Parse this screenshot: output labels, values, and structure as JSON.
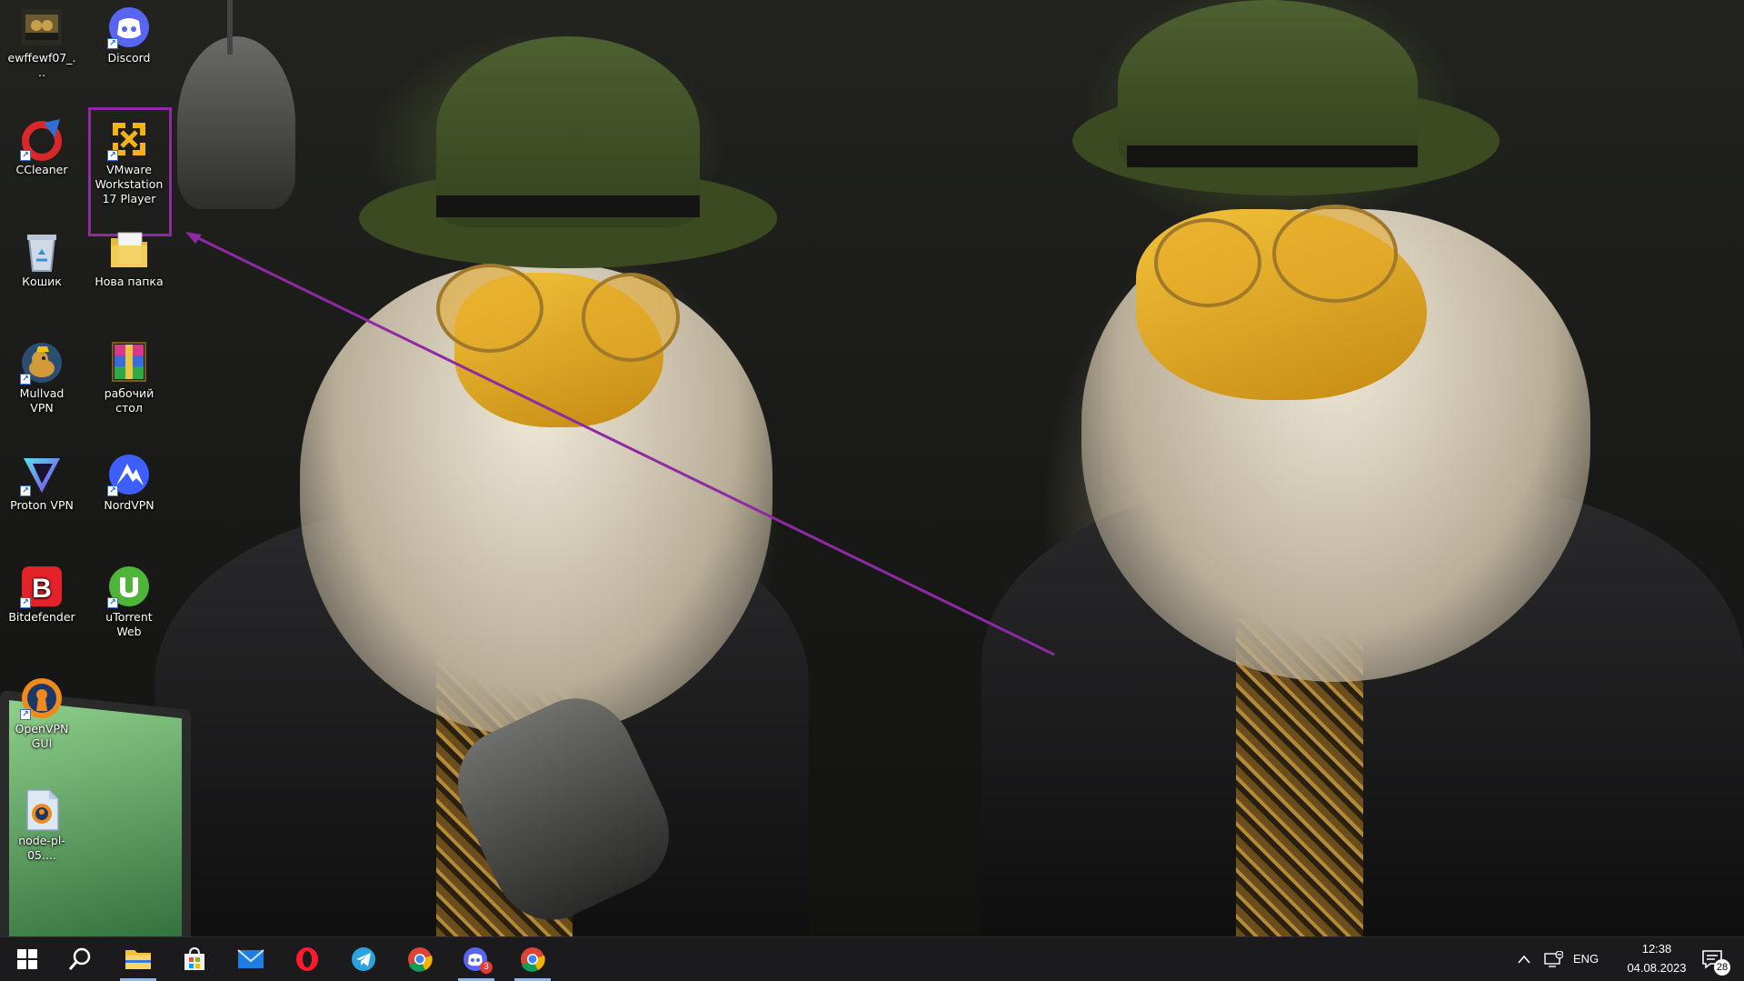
{
  "desktop": {
    "icons": [
      {
        "label": "ewffewf07_...",
        "icon": "game-thumbnail-icon"
      },
      {
        "label": "Discord",
        "icon": "discord-icon"
      },
      {
        "label": "CCleaner",
        "icon": "ccleaner-icon"
      },
      {
        "label": "VMware Workstation 17 Player",
        "icon": "vmware-icon",
        "selected": true
      },
      {
        "label": "Кошик",
        "icon": "recycle-bin-icon"
      },
      {
        "label": "Нова папка",
        "icon": "folder-icon"
      },
      {
        "label": "Mullvad VPN",
        "icon": "mullvad-icon"
      },
      {
        "label": "рабочий стол",
        "icon": "winrar-archive-icon"
      },
      {
        "label": "Proton VPN",
        "icon": "protonvpn-icon"
      },
      {
        "label": "NordVPN",
        "icon": "nordvpn-icon"
      },
      {
        "label": "Bitdefender",
        "icon": "bitdefender-icon"
      },
      {
        "label": "uTorrent Web",
        "icon": "utorrent-icon"
      },
      {
        "label": "OpenVPN GUI",
        "icon": "openvpn-icon"
      },
      {
        "label": "node-pl-05....",
        "icon": "openvpn-config-file-icon"
      }
    ],
    "annotation": {
      "color": "#8e2aa3"
    }
  },
  "taskbar": {
    "pinned": [
      {
        "icon": "windows-start-icon"
      },
      {
        "icon": "search-icon"
      },
      {
        "icon": "file-explorer-icon",
        "active": true
      },
      {
        "icon": "microsoft-store-icon"
      },
      {
        "icon": "mail-icon"
      },
      {
        "icon": "opera-icon"
      },
      {
        "icon": "telegram-icon"
      },
      {
        "icon": "chrome-icon"
      },
      {
        "icon": "discord-icon",
        "badge": "3",
        "active": true
      },
      {
        "icon": "chrome-canary-icon",
        "active": true
      }
    ],
    "tray": {
      "language": "ENG",
      "time": "12:38",
      "date": "04.08.2023",
      "notification_count": "28"
    }
  }
}
